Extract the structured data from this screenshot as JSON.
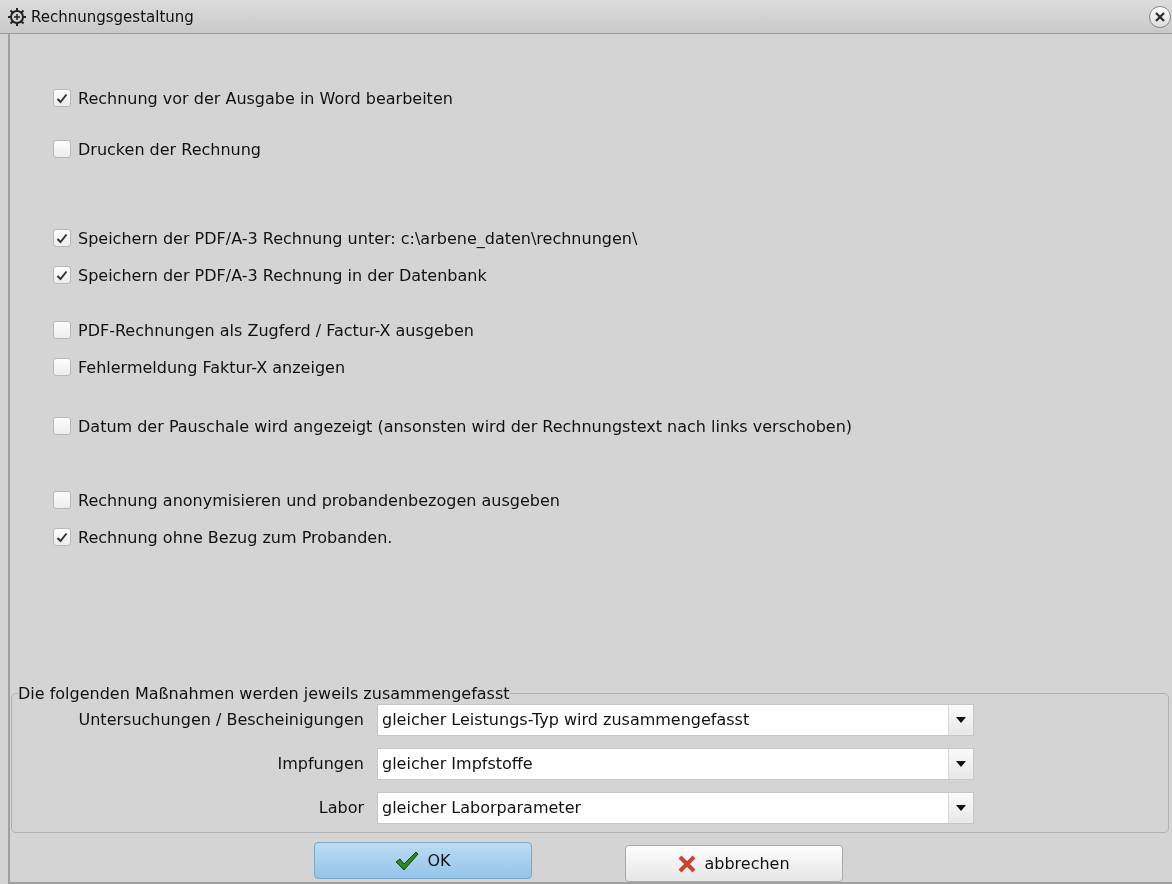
{
  "window": {
    "title": "Rechnungsgestaltung"
  },
  "option_groups": [
    {
      "options": [
        {
          "label": "Rechnung vor der Ausgabe in Word bearbeiten",
          "checked": true
        }
      ]
    },
    {
      "options": [
        {
          "label": "Drucken der Rechnung",
          "checked": false
        }
      ]
    },
    {
      "options": [
        {
          "label": "Speichern der PDF/A-3 Rechnung unter: c:\\arbene_daten\\rechnungen\\",
          "checked": true
        },
        {
          "label": "Speichern der PDF/A-3 Rechnung in der Datenbank",
          "checked": true
        }
      ]
    },
    {
      "options": [
        {
          "label": "PDF-Rechnungen als Zugferd / Factur-X ausgeben",
          "checked": false
        },
        {
          "label": "Fehlermeldung Faktur-X anzeigen",
          "checked": false
        }
      ]
    },
    {
      "options": [
        {
          "label": "Datum der Pauschale wird angezeigt (ansonsten wird der Rechnungstext nach links verschoben)",
          "checked": false
        }
      ]
    },
    {
      "options": [
        {
          "label": "Rechnung anonymisieren und probandenbezogen ausgeben",
          "checked": false
        },
        {
          "label": "Rechnung ohne Bezug zum Probanden.",
          "checked": true
        }
      ]
    }
  ],
  "summary_group": {
    "title": "Die folgenden Maßnahmen werden jeweils zusammengefasst",
    "rows": [
      {
        "label": "Untersuchungen / Bescheinigungen",
        "value": "gleicher Leistungs-Typ wird zusammengefasst"
      },
      {
        "label": "Impfungen",
        "value": "gleicher Impfstoffe"
      },
      {
        "label": "Labor",
        "value": "gleicher Laborparameter"
      }
    ]
  },
  "buttons": [
    {
      "kind": "ok",
      "label": "OK"
    },
    {
      "kind": "cancel",
      "label": "abbrechen"
    }
  ]
}
